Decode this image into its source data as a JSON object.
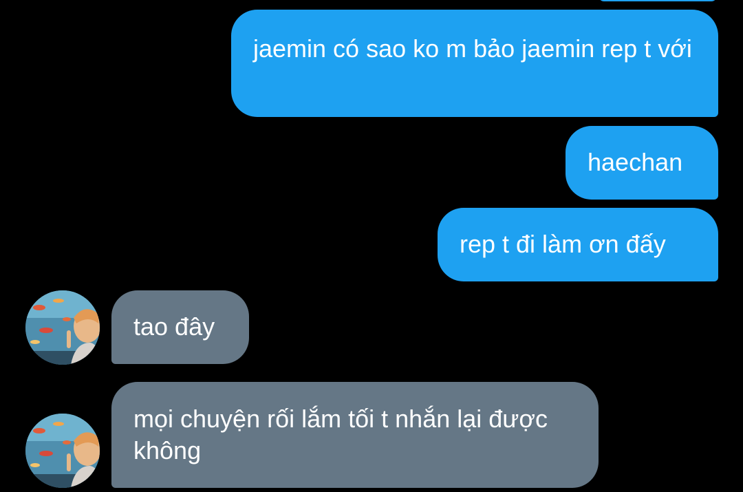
{
  "conversation": {
    "messages": [
      {
        "direction": "outgoing",
        "text": "jaemin có sao ko m bảo jaemin rep t với"
      },
      {
        "direction": "outgoing",
        "text": "haechan"
      },
      {
        "direction": "outgoing",
        "text": "rep t đi làm ơn đấy"
      },
      {
        "direction": "incoming",
        "text": "tao đây"
      },
      {
        "direction": "incoming",
        "text": "mọi chuyện rối lắm tối t nhắn lại được không"
      }
    ]
  },
  "colors": {
    "background": "#000000",
    "outgoing_bubble": "#1ea1f1",
    "incoming_bubble": "#657786",
    "text": "#ffffff"
  },
  "icons": {
    "avatar": "contact-avatar-photo"
  }
}
